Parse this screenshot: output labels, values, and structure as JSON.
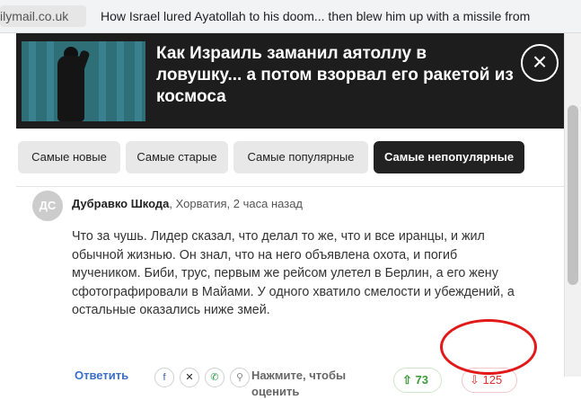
{
  "browser": {
    "tab_domain": "ilymail.co.uk",
    "tab_title": "How Israel lured Ayatollah to his doom... then blew him up with a missile from"
  },
  "header": {
    "title": "Как Израиль заманил аятоллу в ловушку... а потом взорвал его ракетой из космоса",
    "close_icon": "×"
  },
  "sort": {
    "options": [
      "Самые новые",
      "Самые старые",
      "Самые популярные",
      "Самые непопулярные"
    ],
    "active": "Самые непопулярные"
  },
  "comment": {
    "avatar_initials": "ДС",
    "author": "Дубравко Шкода",
    "location_time": ", Хорватия, 2 часа назад",
    "text": "Что за чушь. Лидер сказал, что делал то же, что и все иранцы, и жил обычной жизнью. Он знал, что на него объявлена охота, и погиб мучеником. Биби, трус, первым же рейсом улетел в Берлин, а его жену сфотографировали в Майами. У одного хватило смелости и убеждений, а остальные оказались ниже змей.",
    "reply_label": "Ответить",
    "share_icons": [
      "facebook-icon",
      "x-icon",
      "whatsapp-icon",
      "link-icon"
    ],
    "rate_label": "Нажмите, чтобы оценить",
    "upvotes": "73",
    "downvotes": "125"
  },
  "colors": {
    "header_bg": "#1d1d1d",
    "active_sort_bg": "#222222",
    "upvote": "#3a9a3a",
    "downvote": "#dd3333",
    "annotation": "#e11919"
  }
}
